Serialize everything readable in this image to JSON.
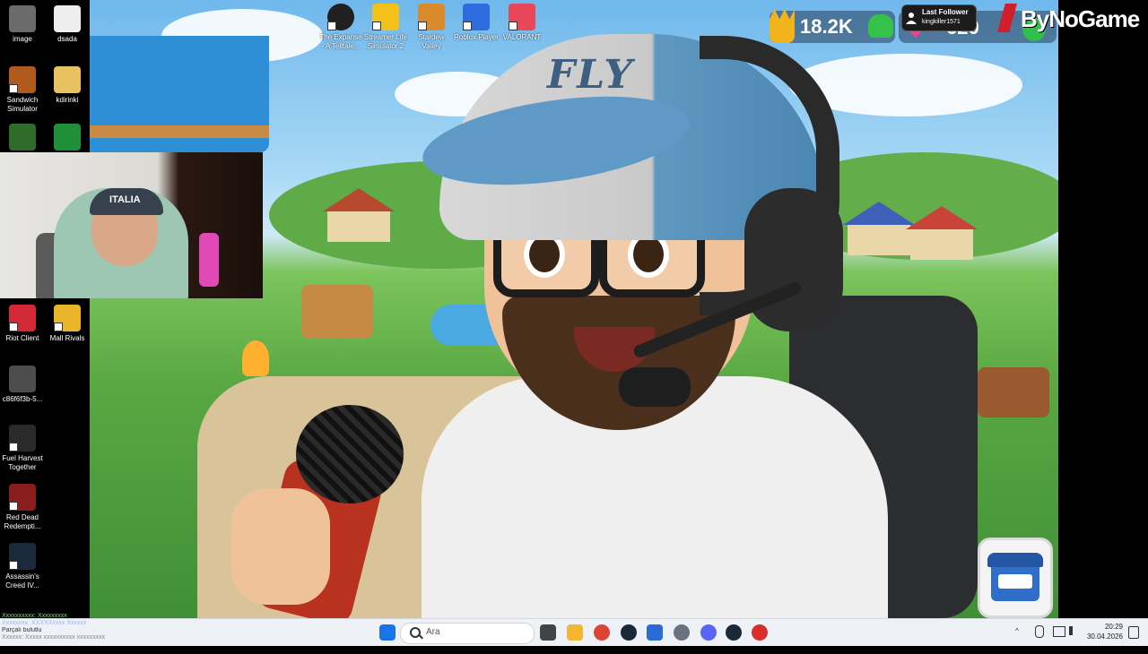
{
  "desktop_icons": [
    {
      "label": "image",
      "color": "#6b6b6b"
    },
    {
      "label": "dsada",
      "color": "#eeeeee"
    },
    {
      "label": "Sandwich Simulator",
      "color": "#b15a1e"
    },
    {
      "label": "kdirinki",
      "color": "#e8c260"
    },
    {
      "label": "",
      "color": "#2f6b2a"
    },
    {
      "label": "",
      "color": "#1f8f3a"
    },
    {
      "label": "Riot Client",
      "color": "#d32936"
    },
    {
      "label": "Mall Rivals",
      "color": "#e9b52a"
    },
    {
      "label": "c86f6f3b-5...",
      "color": "#4d4d4d"
    },
    {
      "label": "Fuel Harvest Together",
      "color": "#2a2a2a"
    },
    {
      "label": "Red Dead Redempti...",
      "color": "#8a1d1d"
    },
    {
      "label": "Assassin's Creed IV...",
      "color": "#1b2a3a"
    }
  ],
  "top_icons": [
    {
      "label": "The Expanse - A Telltale...",
      "color": "#202020"
    },
    {
      "label": "Streamer Life Simulator 2",
      "color": "#f2c21b"
    },
    {
      "label": "Stardew Valley",
      "color": "#d98b2c"
    },
    {
      "label": "Roblox Player",
      "color": "#2d6cdf"
    },
    {
      "label": "VALORANT",
      "color": "#e8475a"
    }
  ],
  "wallpaper": {
    "cap_text": "FLY"
  },
  "hud": {
    "score": "18.2K",
    "gems": "620"
  },
  "last_follower": {
    "label": "Last Follower",
    "name": "kingkiller1571"
  },
  "logo": {
    "text": "ByNoGame"
  },
  "webcam": {
    "cap_text": "ITALIA"
  },
  "chat_overlay": [
    "Xxxxxxxxxx: Xxxxxxxxx",
    "Xxxxxxxx: XXXXXxxxx Xxxxxx",
    "Parçalı bulutlu",
    "Xxxxxx: Xxxxx xxxxxxxxxx xxxxxxxxx"
  ],
  "taskbar": {
    "search_placeholder": "Ara",
    "apps": [
      {
        "name": "windows-start-icon",
        "color": "#1a73e8"
      },
      {
        "name": "task-view-icon",
        "color": "#444444"
      },
      {
        "name": "file-explorer-icon",
        "color": "#f2b632"
      },
      {
        "name": "chrome-icon",
        "color": "#db4437"
      },
      {
        "name": "steam-icon",
        "color": "#1b2838"
      },
      {
        "name": "store-icon",
        "color": "#2b6bd6"
      },
      {
        "name": "settings-icon",
        "color": "#6b7280"
      },
      {
        "name": "discord-icon",
        "color": "#5865f2"
      },
      {
        "name": "steam-icon-2",
        "color": "#1b2838"
      },
      {
        "name": "record-app-icon",
        "color": "#d62d2d"
      }
    ],
    "time": "20:29",
    "date": "30.04.2026"
  }
}
